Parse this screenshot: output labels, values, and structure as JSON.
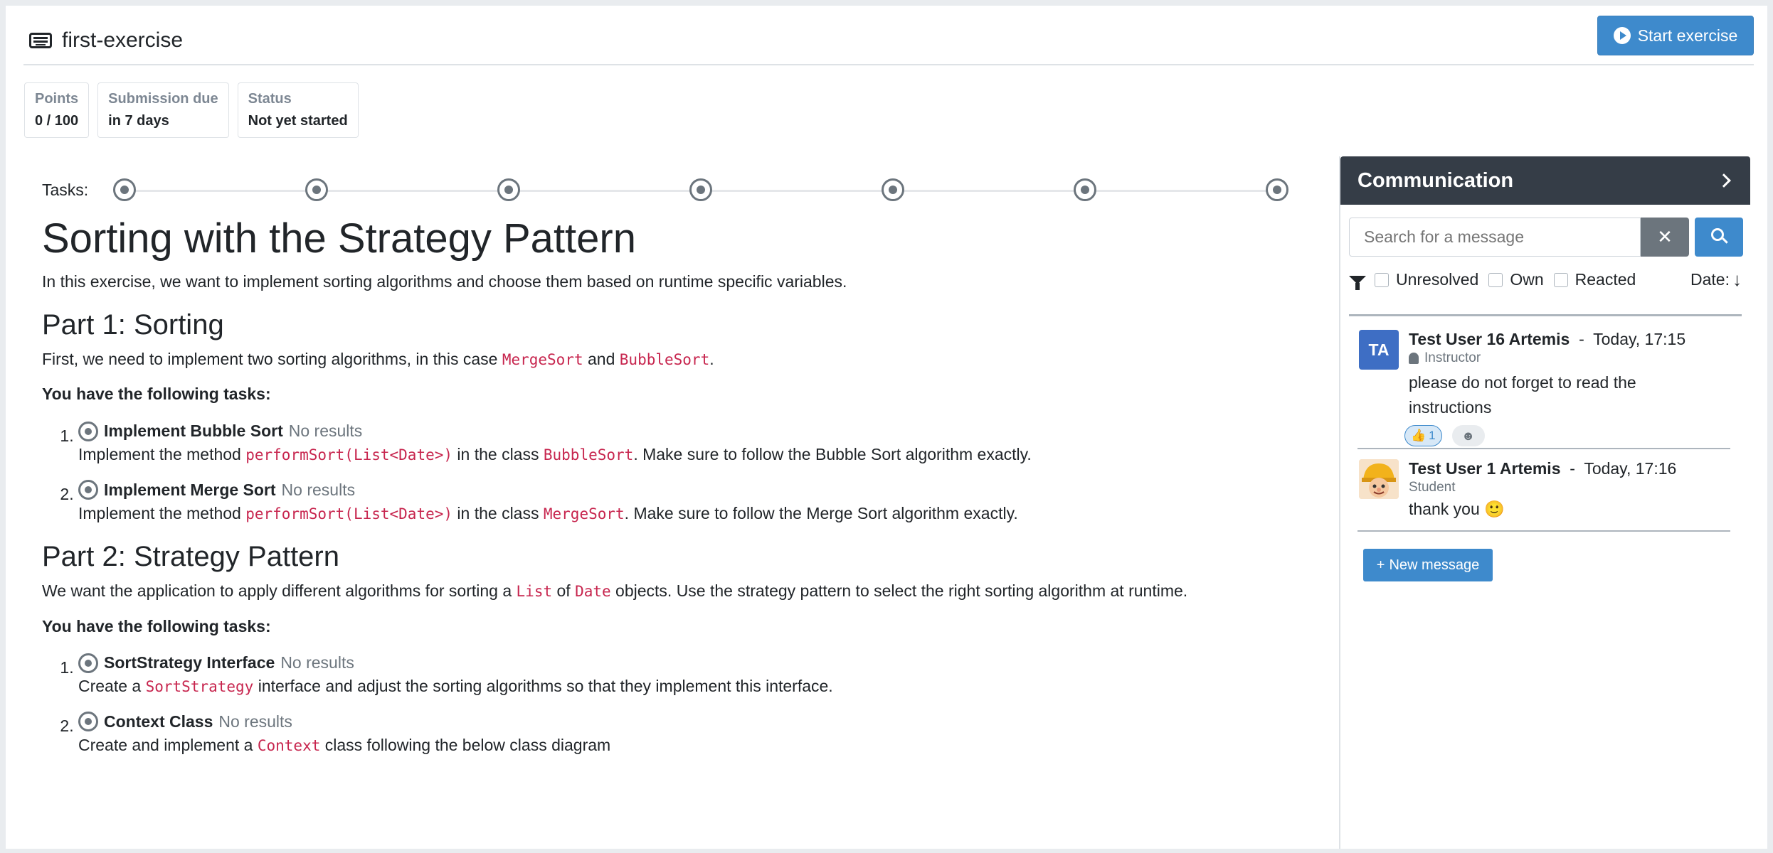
{
  "header": {
    "title": "first-exercise",
    "title_icon": "keyboard-icon",
    "start_button": "Start exercise",
    "start_icon": "play-circle-icon"
  },
  "info": [
    {
      "label": "Points",
      "value": "0 / 100"
    },
    {
      "label": "Submission due",
      "value": "in 7 days"
    },
    {
      "label": "Status",
      "value": "Not yet started"
    }
  ],
  "tasks": {
    "label": "Tasks:",
    "count": 7
  },
  "problem": {
    "title": "Sorting with the Strategy Pattern",
    "intro": "In this exercise, we want to implement sorting algorithms and choose them based on runtime specific variables.",
    "part1": {
      "heading": "Part 1: Sorting",
      "text_a": "First, we need to implement two sorting algorithms, in this case ",
      "code_a": "MergeSort",
      "text_b": " and ",
      "code_b": "BubbleSort",
      "text_c": ".",
      "tasks_intro": "You have the following tasks:",
      "items": [
        {
          "num": "1.",
          "name": "Implement Bubble Sort",
          "status": "No results",
          "d1": "Implement the method ",
          "c1": "performSort(List<Date>)",
          "d2": " in the class ",
          "c2": "BubbleSort",
          "d3": ". Make sure to follow the Bubble Sort algorithm exactly."
        },
        {
          "num": "2.",
          "name": "Implement Merge Sort",
          "status": "No results",
          "d1": "Implement the method ",
          "c1": "performSort(List<Date>)",
          "d2": " in the class ",
          "c2": "MergeSort",
          "d3": ". Make sure to follow the Merge Sort algorithm exactly."
        }
      ]
    },
    "part2": {
      "heading": "Part 2: Strategy Pattern",
      "text_a": "We want the application to apply different algorithms for sorting a ",
      "code_a": "List",
      "text_b": " of ",
      "code_b": "Date",
      "text_c": " objects. Use the strategy pattern to select the right sorting algorithm at runtime.",
      "tasks_intro": "You have the following tasks:",
      "items": [
        {
          "num": "1.",
          "name": "SortStrategy Interface",
          "status": "No results",
          "d1": "Create a ",
          "c1": "SortStrategy",
          "d2": " interface and adjust the sorting algorithms so that they implement this interface."
        },
        {
          "num": "2.",
          "name": "Context Class",
          "status": "No results",
          "d1": "Create and implement a ",
          "c1": "Context",
          "d2": " class following the below class diagram"
        }
      ]
    }
  },
  "communication": {
    "title": "Communication",
    "search_placeholder": "Search for a message",
    "filters": [
      "Unresolved",
      "Own",
      "Reacted"
    ],
    "date_sort": "Date:",
    "messages": [
      {
        "avatar": "TA",
        "author": "Test User 16 Artemis",
        "sep": "-",
        "time": "Today, 17:15",
        "role": "Instructor",
        "text": "please do not forget to read the instructions",
        "reaction_emoji": "👍",
        "reaction_count": "1",
        "add_reaction": "☻"
      },
      {
        "avatar": "",
        "author": "Test User 1 Artemis",
        "sep": "-",
        "time": "Today, 17:16",
        "role": "Student",
        "text": "thank you 🙂"
      }
    ],
    "new_message": "New message"
  }
}
